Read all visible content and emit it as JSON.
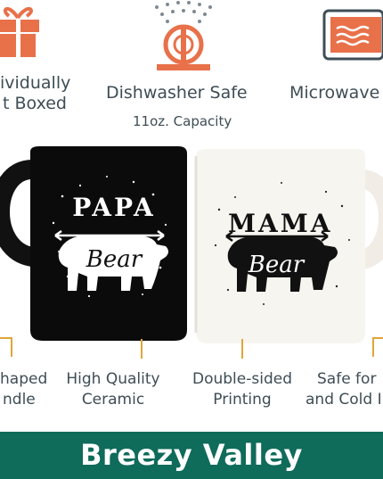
{
  "features": {
    "boxed": [
      "ividually",
      "t Boxed"
    ],
    "dishwasher": "Dishwasher Safe",
    "microwave": "Microwave",
    "capacity": "11oz. Capacity"
  },
  "mugs": {
    "papa_word": "PAPA",
    "papa_script": "Bear",
    "mama_word": "MAMA",
    "mama_script": "Bear"
  },
  "labels": {
    "handle": [
      "haped",
      "ndle"
    ],
    "ceramic": [
      "High Quality",
      "Ceramic"
    ],
    "printing": [
      "Double-sided",
      "Printing"
    ],
    "safe": [
      "Safe for",
      "and Cold I"
    ]
  },
  "brand": "Breezy Valley",
  "colors": {
    "accent_orange": "#e8714a",
    "banner_green": "#0f6b5a",
    "tick_gold": "#e0a53a"
  }
}
